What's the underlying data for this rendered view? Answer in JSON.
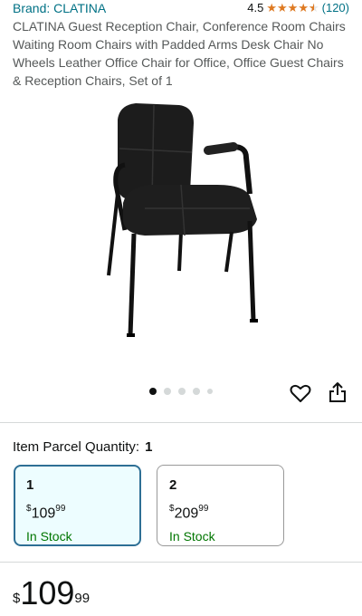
{
  "brand": "Brand: CLATINA",
  "rating": {
    "value": "4.5",
    "stars": 4.5,
    "count": "(120)",
    "color": "#de7921"
  },
  "title": "CLATINA Guest Reception Chair, Conference Room Chairs Waiting Room Chairs with Padded Arms Desk Chair No Wheels Leather Office Chair for Office, Office Guest Chairs & Reception Chairs, Set of 1",
  "gallery": {
    "image": "black-leather-guest-chair-photo",
    "active_index": 1,
    "total": 5
  },
  "icons": {
    "wishlist": "heart-icon",
    "share": "share-icon"
  },
  "quantity": {
    "label": "Item Parcel Quantity:",
    "value": "1"
  },
  "options": [
    {
      "qty": "1",
      "currency": "$",
      "price_whole": "109",
      "price_fraction": "99",
      "stock": "In Stock",
      "selected": true
    },
    {
      "qty": "2",
      "currency": "$",
      "price_whole": "209",
      "price_fraction": "99",
      "stock": "In Stock",
      "selected": false
    }
  ],
  "price": {
    "currency": "$",
    "whole": "109",
    "fraction": "99"
  },
  "colors": {
    "link": "#007185",
    "in_stock": "#007600",
    "selected_border": "#2e6f95",
    "selected_bg": "#edfdff"
  }
}
